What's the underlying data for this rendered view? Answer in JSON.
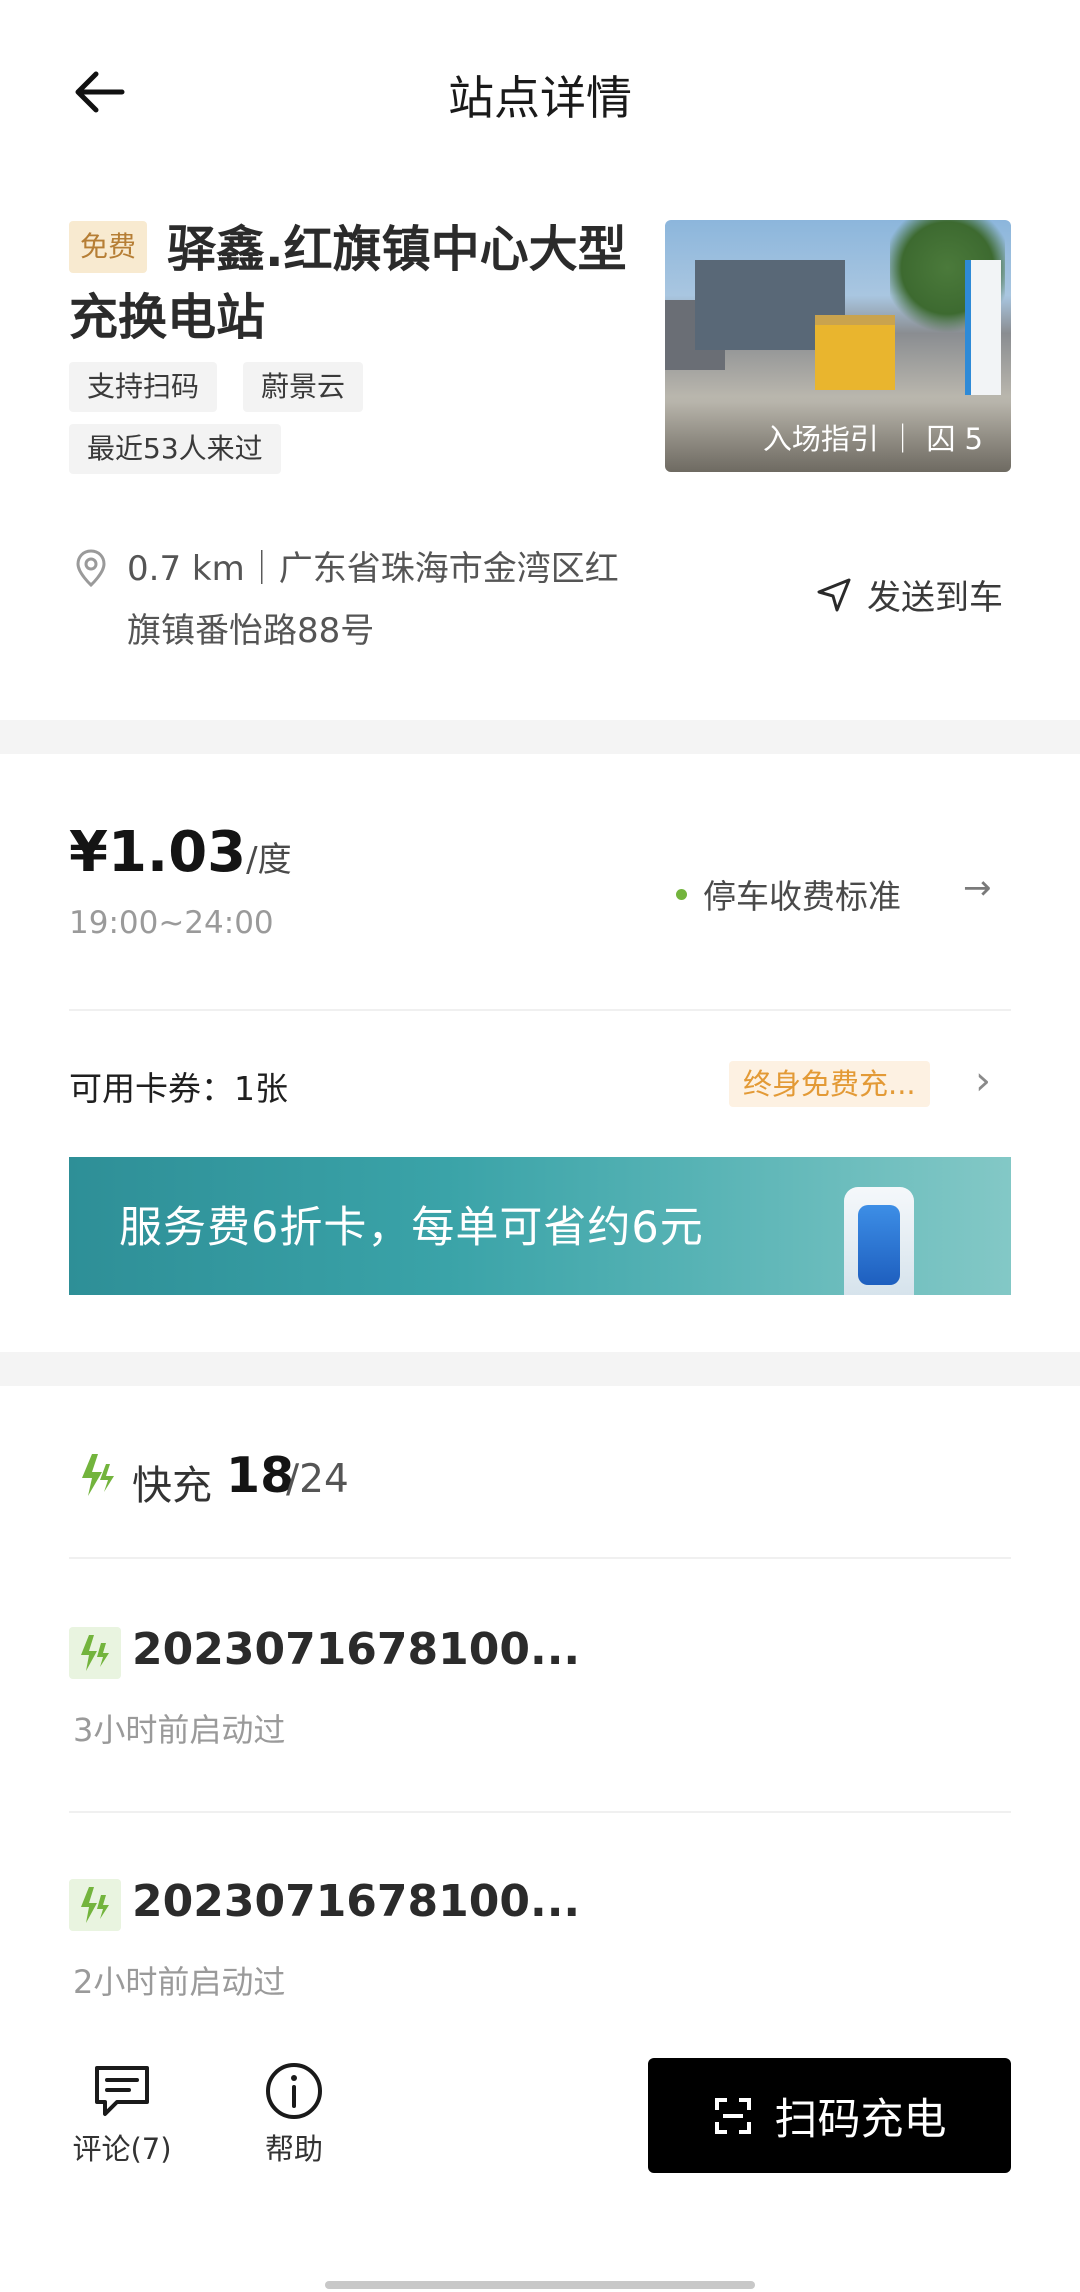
{
  "header": {
    "title": "站点详情"
  },
  "station": {
    "free_badge": "免费",
    "name": "驿鑫.红旗镇中心大型充换电站",
    "tags": [
      "支持扫码",
      "蔚景云"
    ],
    "visitors": "最近53人来过",
    "photo_caption": "入场指引 ｜ 囚 5",
    "distance_address": "0.7 km｜广东省珠海市金湾区红旗镇番怡路88号",
    "send_to_car": "发送到车"
  },
  "price": {
    "amount": "¥1.03",
    "unit": "/度",
    "time_range": "19:00~24:00",
    "parking_fee": "停车收费标准"
  },
  "coupon": {
    "label": "可用卡券：1张",
    "tag": "终身免费充..."
  },
  "banner": {
    "text": "服务费6折卡，每单可省约6元"
  },
  "fast_charge": {
    "label": "快充",
    "available": "18",
    "total": "/24"
  },
  "piles": [
    {
      "id": "2023071678100...",
      "status": "3小时前启动过"
    },
    {
      "id": "2023071678100...",
      "status": "2小时前启动过"
    }
  ],
  "bottom_bar": {
    "comments": "评论(7)",
    "help": "帮助",
    "scan_charge": "扫码充电"
  },
  "colors": {
    "accent_green": "#73b43d",
    "badge_bg": "#f8ead0",
    "coupon_orange": "#e39a36"
  }
}
